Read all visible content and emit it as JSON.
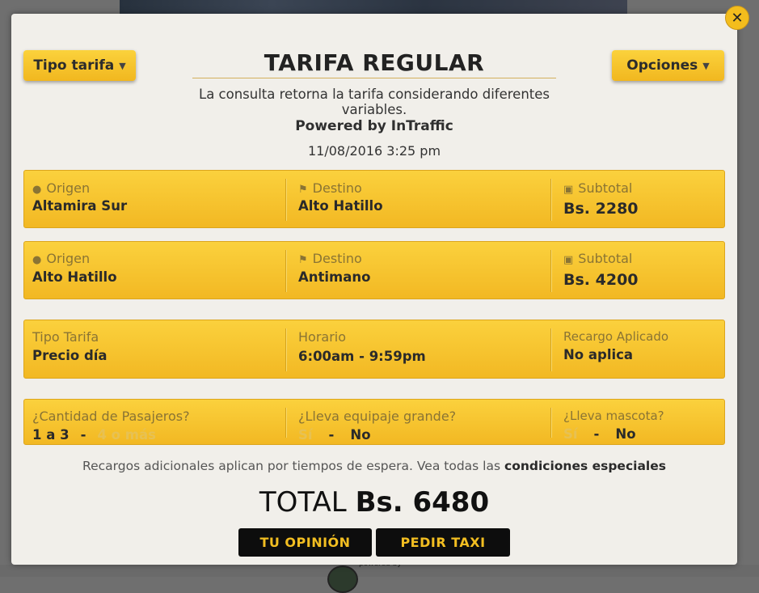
{
  "header": {
    "tipo_tarifa_label": "Tipo tarifa",
    "title": "TARIFA REGULAR",
    "opciones_label": "Opciones",
    "description": "La consulta retorna la tarifa considerando diferentes variables.",
    "powered": "Powered by InTraffic",
    "datetime": "11/08/2016 3:25 pm"
  },
  "routes": [
    {
      "origin_label": "Origen",
      "origin": "Altamira Sur",
      "dest_label": "Destino",
      "dest": "Alto Hatillo",
      "subtotal_label": "Subtotal",
      "subtotal": "Bs. 2280"
    },
    {
      "origin_label": "Origen",
      "origin": "Alto Hatillo",
      "dest_label": "Destino",
      "dest": "Antimano",
      "subtotal_label": "Subtotal",
      "subtotal": "Bs. 4200"
    }
  ],
  "fare_info": {
    "tipo_label": "Tipo Tarifa",
    "tipo": "Precio día",
    "horario_label": "Horario",
    "horario": "6:00am - 9:59pm",
    "recargo_label": "Recargo Aplicado",
    "recargo": "No aplica"
  },
  "options": {
    "pasajeros_label": "¿Cantidad de Pasajeros?",
    "pasajeros_opt1": "1 a 3",
    "pasajeros_opt2": "4 o más",
    "equipaje_label": "¿Lleva equipaje grande?",
    "equipaje_opt1": "Sí",
    "equipaje_opt2": "No",
    "mascota_label": "¿Lleva mascota?",
    "mascota_opt1": "Sí",
    "mascota_opt2": "No",
    "separator": "-"
  },
  "footer": {
    "note": "Recargos adicionales aplican por tiempos de espera. Vea todas las",
    "note_link": "condiciones especiales",
    "total_label": "TOTAL",
    "total_value": "Bs. 6480",
    "opinion_button": "TU OPINIÓN",
    "taxi_button": "PEDIR TAXI"
  },
  "background": {
    "powered_by": "powered by"
  },
  "icons": {
    "close": "close-icon",
    "caret": "chevron-down-icon",
    "origin": "map-pin-icon",
    "destination": "flag-icon",
    "subtotal": "money-icon"
  },
  "colors": {
    "accent": "#f3bd1d",
    "modal_bg": "#f1efea",
    "button_dark": "#0d0d0d"
  }
}
